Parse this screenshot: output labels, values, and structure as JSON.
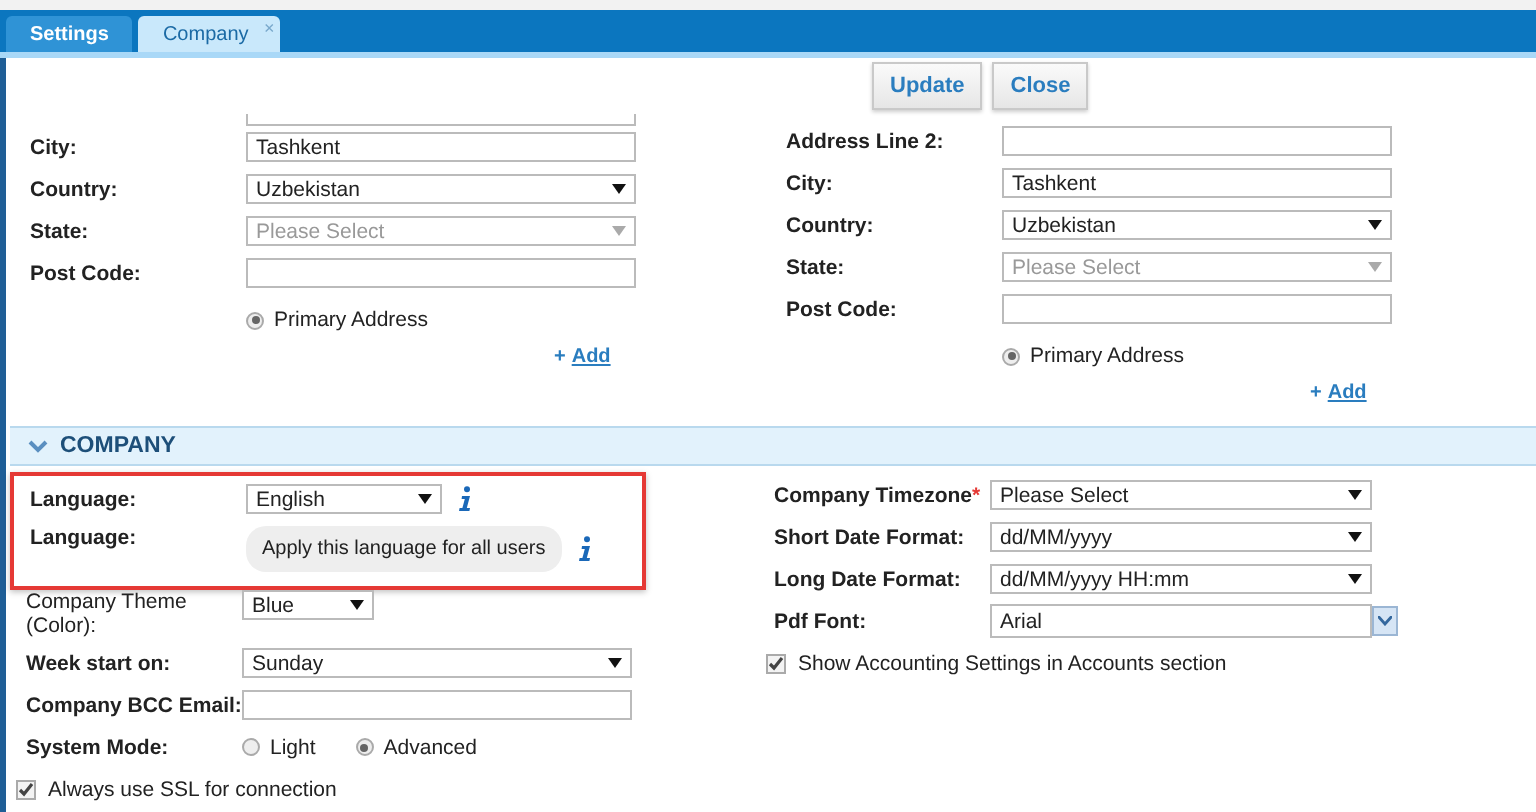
{
  "tabs": [
    {
      "label": "Settings",
      "selected": false
    },
    {
      "label": "Company",
      "selected": true,
      "close": "×"
    }
  ],
  "toolbar": {
    "buttons": [
      "Update",
      "Close"
    ]
  },
  "address_left": {
    "fields": [
      {
        "kind": "text-cut"
      },
      {
        "kind": "text",
        "label": "City:",
        "value": "Tashkent"
      },
      {
        "kind": "select",
        "label": "Country:",
        "value": "Uzbekistan",
        "disabled": false
      },
      {
        "kind": "select",
        "label": "State:",
        "value": "Please Select",
        "disabled": true
      },
      {
        "kind": "text",
        "label": "Post Code:"
      }
    ],
    "primary": {
      "label": "Primary Address",
      "selected": true
    },
    "add_link": {
      "icon": "+",
      "label": "Add"
    }
  },
  "address_right": {
    "fields": [
      {
        "kind": "text",
        "label": "Address Line 2:"
      },
      {
        "kind": "text",
        "label": "City:",
        "value": "Tashkent"
      },
      {
        "kind": "select",
        "label": "Country:",
        "value": "Uzbekistan",
        "disabled": false
      },
      {
        "kind": "select",
        "label": "State:",
        "value": "Please Select",
        "disabled": true
      },
      {
        "kind": "text",
        "label": "Post Code:"
      }
    ],
    "primary": {
      "label": "Primary Address",
      "selected": true
    },
    "add_link": {
      "icon": "+",
      "label": "Add"
    }
  },
  "section": {
    "title": "COMPANY",
    "expanded": true
  },
  "company_left": [
    {
      "kind": "select",
      "label": "Language:",
      "value": "English",
      "info": true,
      "highlighted": true
    },
    {
      "kind": "pill",
      "label": "Language:",
      "value": "Apply this language for all users",
      "info": true,
      "highlighted": true
    },
    {
      "kind": "select-short",
      "label": "Company Theme (Color):",
      "value": "Blue",
      "highlighted": false
    },
    {
      "kind": "select",
      "label": "Week start on:",
      "value": "Sunday",
      "highlighted": false
    },
    {
      "kind": "text",
      "label": "Company BCC Email:",
      "highlighted": false
    },
    {
      "kind": "radio-group",
      "label": "System Mode:",
      "options": [
        {
          "label": "Light",
          "selected": false
        },
        {
          "label": "Advanced",
          "selected": true
        }
      ],
      "highlighted": false
    },
    {
      "kind": "checkbox",
      "label": "Always use SSL for connection",
      "checked": true,
      "highlighted": false
    }
  ],
  "company_right": [
    {
      "kind": "select",
      "label": "Company Timezone",
      "required_mark": "*",
      "value": "Please Select"
    },
    {
      "kind": "select",
      "label": "Short Date Format:",
      "value": "dd/MM/yyyy"
    },
    {
      "kind": "select",
      "label": "Long Date Format:",
      "value": "dd/MM/yyyy HH:mm"
    },
    {
      "kind": "combo",
      "label": "Pdf Font:",
      "value": "Arial"
    },
    {
      "kind": "checkbox",
      "label": "Show Accounting Settings in Accounts section",
      "checked": true
    }
  ]
}
